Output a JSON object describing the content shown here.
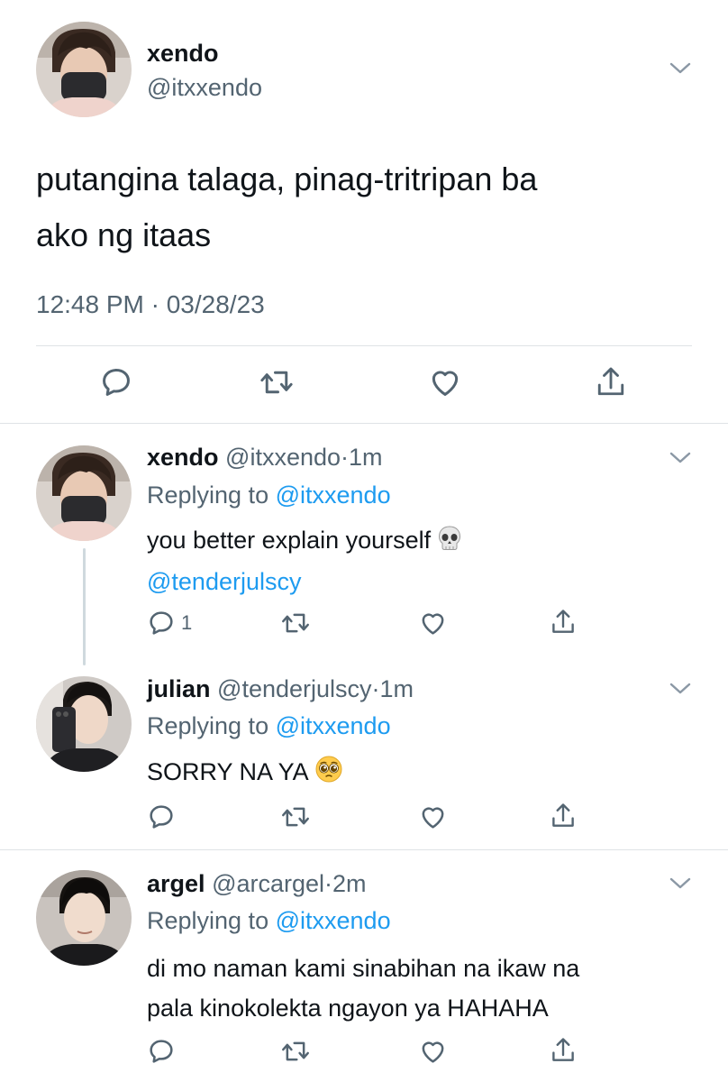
{
  "main_tweet": {
    "name": "xendo",
    "handle": "@itxxendo",
    "text_line1": "putangina talaga, pinag-tritripan ba",
    "text_line2": "ako ng itaas",
    "timestamp": "12:48 PM · 03/28/23",
    "avatar_icon": "masked-person-avatar"
  },
  "replies": [
    {
      "name": "xendo",
      "handle": "@itxxendo",
      "separator": "·",
      "time": "1m",
      "replying_label": "Replying to",
      "replying_to": "@itxxendo",
      "text": "you better explain yourself",
      "emoji": "skull-emoji",
      "mention": "@tenderjulscy",
      "reply_count": "1"
    },
    {
      "name": "julian",
      "handle": "@tenderjulscy",
      "separator": "·",
      "time": "1m",
      "replying_label": "Replying to",
      "replying_to": "@itxxendo",
      "text": "SORRY NA YA",
      "emoji": "pleading-face-emoji"
    },
    {
      "name": "argel",
      "handle": "@arcargel",
      "separator": "·",
      "time": "2m",
      "replying_label": "Replying to",
      "replying_to": "@itxxendo",
      "text_line1": "di mo naman kami sinabihan na ikaw na",
      "text_line2": "pala kinokolekta ngayon ya HAHAHA"
    }
  ],
  "icons": {
    "reply": "reply-icon",
    "retweet": "retweet-icon",
    "like": "heart-icon",
    "share": "share-icon",
    "more": "chevron-down-icon"
  },
  "colors": {
    "text": "#0f1419",
    "secondary": "#536471",
    "link": "#1d9bf0",
    "divider": "#dfe3e6"
  }
}
